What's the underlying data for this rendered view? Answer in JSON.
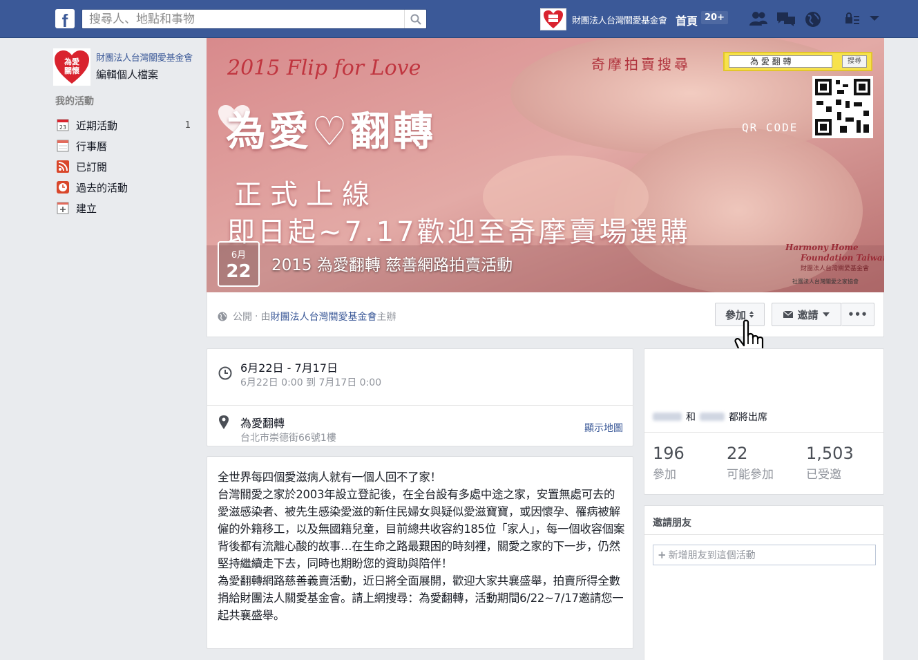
{
  "topbar": {
    "search_placeholder": "搜尋人、地點和事物",
    "page_name": "財團法人台灣關愛基金會",
    "home_label": "首頁",
    "notification_count": "20+"
  },
  "sidebar": {
    "page_name": "財團法人台灣關愛基金會",
    "edit_profile": "編輯個人檔案",
    "section_title": "我的活動",
    "items": [
      {
        "label": "近期活動",
        "count": "1",
        "icon": "calendar-23-icon"
      },
      {
        "label": "行事曆",
        "count": "",
        "icon": "calendar-icon"
      },
      {
        "label": "已訂閱",
        "count": "",
        "icon": "rss-icon"
      },
      {
        "label": "過去的活動",
        "count": "",
        "icon": "clock-icon"
      },
      {
        "label": "建立",
        "count": "",
        "icon": "plus-icon"
      }
    ]
  },
  "cover": {
    "headline_en": "2015 Flip for Love",
    "headline_zh": "為愛♡翻轉",
    "line1": "正式上線",
    "line2": "即日起~7.17歡迎至奇摩賣場選購",
    "yahoo_search_label": "奇摩拍賣搜尋",
    "search_box_text": "為 愛 翻 轉",
    "search_button": "搜尋",
    "qr_label": "QR CODE",
    "org_en_1": "Harmony Home",
    "org_en_2": "Foundation Taiwan",
    "org_zh": "財團法人台灣關愛基金會",
    "assoc": "社團法人台灣關愛之家協會"
  },
  "event": {
    "month": "6月",
    "day": "22",
    "title": "2015 為愛翻轉 慈善網路拍賣活動",
    "privacy": "公開",
    "host_prefix": "由",
    "host": "財團法人台灣關愛基金會",
    "host_suffix": "主辦",
    "join_label": "參加",
    "invite_label": "邀請",
    "more_label": "•••"
  },
  "details": {
    "date_main": "6月22日 - 7月17日",
    "date_sub": "6月22日 0:00 到 7月17日 0:00",
    "place_main": "為愛翻轉",
    "place_sub": "台北市崇德街66號1樓",
    "map_link": "顯示地圖"
  },
  "description": [
    "全世界每四個愛滋病人就有一個人回不了家！",
    "台灣關愛之家於2003年設立登記後，在全台設有多處中途之家，安置無處可去的愛滋感染者、被先生感染愛滋的新住民婦女與疑似愛滋寶寶，或因懷孕、罹病被解僱的外籍移工，以及無國籍兒童，目前總共收容約185位「家人」，每一個收容個案背後都有流離心酸的故事…在生命之路最艱困的時刻裡，關愛之家的下一步，仍然堅持繼續走下去，同時也期盼您的資助與陪伴！",
    "為愛翻轉網路慈善義賣活動，近日將全面展開，歡迎大家共襄盛舉，拍賣所得全數捐給財團法人關愛基金會。請上網搜尋：為愛翻轉，活動期間6/22~7/17邀請您一起共襄盛舉。"
  ],
  "attendance": {
    "friends_and": "和",
    "friends_going": "都將出席",
    "stats": [
      {
        "number": "196",
        "label": "參加"
      },
      {
        "number": "22",
        "label": "可能參加"
      },
      {
        "number": "1,503",
        "label": "已受邀"
      }
    ]
  },
  "invite": {
    "title": "邀請朋友",
    "placeholder": "新增朋友到這個活動"
  },
  "colors": {
    "brand": "#3b5998",
    "background": "#e9ebee",
    "cover": "#d89a96"
  }
}
